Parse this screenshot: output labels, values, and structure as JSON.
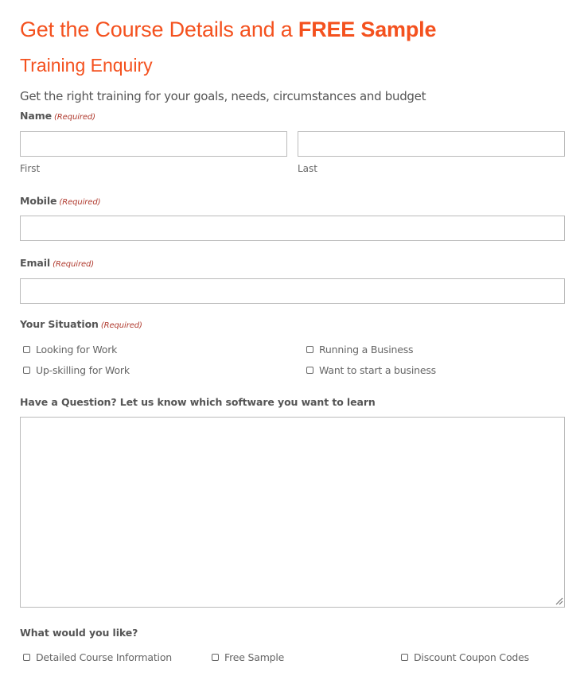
{
  "header": {
    "title_prefix": "Get the Course Details and a ",
    "title_bold": "FREE Sample",
    "subtitle": "Training Enquiry",
    "description": "Get the right training for your goals, needs, circumstances and budget"
  },
  "colors": {
    "accent": "#f4511e",
    "required": "#b03a2e",
    "text": "#555555",
    "border": "#bbbbbb"
  },
  "form": {
    "required_marker": "(Required)",
    "name": {
      "label": "Name",
      "first_value": "",
      "last_value": "",
      "first_sublabel": "First",
      "last_sublabel": "Last"
    },
    "mobile": {
      "label": "Mobile",
      "value": ""
    },
    "email": {
      "label": "Email",
      "value": ""
    },
    "situation": {
      "label": "Your Situation",
      "options": [
        {
          "label": "Looking for Work",
          "checked": false
        },
        {
          "label": "Running a Business",
          "checked": false
        },
        {
          "label": "Up-skilling for Work",
          "checked": false
        },
        {
          "label": "Want to start a business",
          "checked": false
        }
      ]
    },
    "question": {
      "label": "Have a Question? Let us know which software you want to learn",
      "value": ""
    },
    "wants": {
      "label": "What would you like?",
      "options": [
        {
          "label": "Detailed Course Information",
          "checked": false
        },
        {
          "label": "Free Sample",
          "checked": false
        },
        {
          "label": "Discount Coupon Codes",
          "checked": false
        }
      ]
    }
  }
}
